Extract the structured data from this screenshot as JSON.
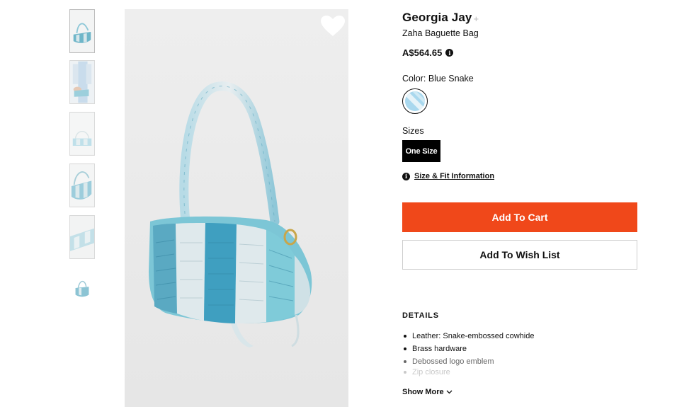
{
  "gallery": {
    "thumbnails": [
      {
        "name": "thumb-1",
        "active": true
      },
      {
        "name": "thumb-2",
        "active": false
      },
      {
        "name": "thumb-3",
        "active": false
      },
      {
        "name": "thumb-4",
        "active": false
      },
      {
        "name": "thumb-5",
        "active": false
      },
      {
        "name": "thumb-6",
        "active": false
      }
    ],
    "wishlist_icon": "heart-icon"
  },
  "product": {
    "brand": "Georgia Jay",
    "brand_follow": "+",
    "name": "Zaha Baguette Bag",
    "price": "A$564.65",
    "price_info_icon": "i",
    "color_label": "Color: Blue Snake",
    "sizes_label": "Sizes",
    "size_option": "One Size",
    "fit_info_icon": "i",
    "fit_link": "Size & Fit Information",
    "add_to_cart": "Add To Cart",
    "add_to_wishlist": "Add To Wish List"
  },
  "details": {
    "title": "DETAILS",
    "items": [
      "Leather: Snake-embossed cowhide",
      "Brass hardware",
      "Debossed logo emblem",
      "Zip closure"
    ],
    "show_more": "Show More"
  },
  "colors": {
    "accent": "#f0481a",
    "swatch_blue": "#a9d8ee"
  }
}
